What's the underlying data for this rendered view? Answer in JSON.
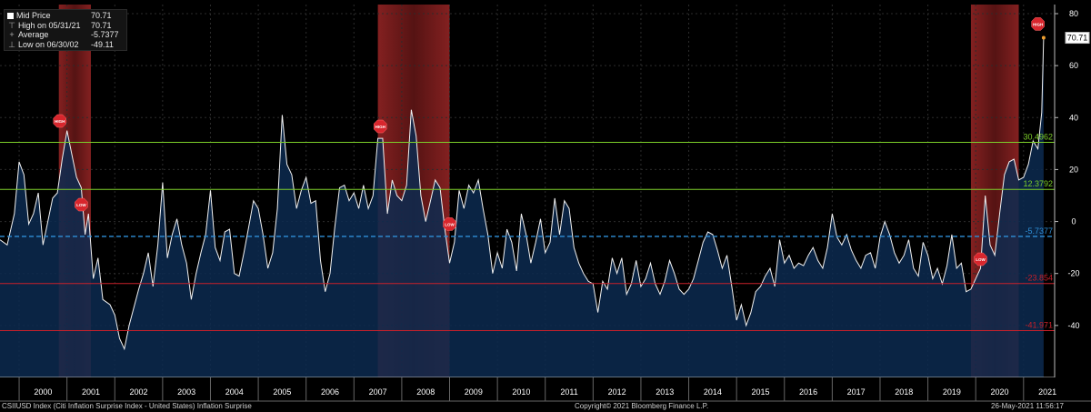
{
  "legend": {
    "items": [
      {
        "label": "Mid Price",
        "value": "70.71",
        "icon": "white-square"
      },
      {
        "label": "High on 05/31/21",
        "value": "70.71",
        "icon": "high-marker"
      },
      {
        "label": "Average",
        "value": "-5.7377",
        "icon": "average-marker"
      },
      {
        "label": "Low on 06/30/02",
        "value": "-49.11",
        "icon": "low-marker"
      }
    ]
  },
  "footer": {
    "title": "CSIIUSD Index (Citi Inflation Surprise Index - United States) Inflation Surprise",
    "copyright": "Copyright© 2021 Bloomberg Finance L.P.",
    "timestamp": "26-May-2021 11:56:17"
  },
  "chart_data": {
    "type": "area",
    "title": "",
    "ylim": [
      -60,
      80
    ],
    "yticks": [
      "80",
      "60",
      "40",
      "20",
      "0",
      "-20",
      "-40"
    ],
    "x_categories": [
      "2000",
      "2001",
      "2002",
      "2003",
      "2004",
      "2005",
      "2006",
      "2007",
      "2008",
      "2009",
      "2010",
      "2011",
      "2012",
      "2013",
      "2014",
      "2015",
      "2016",
      "2017",
      "2018",
      "2019",
      "2020",
      "2021"
    ],
    "grid": true,
    "last_value_label": "70.71",
    "reference_lines": [
      {
        "value": 30.4962,
        "label": "30.4962",
        "color": "#7dcf2a"
      },
      {
        "value": 12.3792,
        "label": "12.3792",
        "color": "#7dcf2a"
      },
      {
        "value": -5.7377,
        "label": "-5.7377",
        "color": "#2f8fd8",
        "style": "dashed"
      },
      {
        "value": -23.854,
        "label": "-23.854",
        "color": "#c8202a"
      },
      {
        "value": -41.971,
        "label": "-41.971",
        "color": "#c8202a"
      }
    ],
    "shaded_periods": [
      {
        "start": 2000.83,
        "end": 2001.5
      },
      {
        "start": 2007.5,
        "end": 2009.0
      },
      {
        "start": 2019.9,
        "end": 2020.9
      }
    ],
    "series": [
      {
        "values": [
          [
            1999.6,
            -7
          ],
          [
            1999.75,
            -9
          ],
          [
            1999.9,
            3
          ],
          [
            2000.0,
            23
          ],
          [
            2000.1,
            18
          ],
          [
            2000.2,
            -1
          ],
          [
            2000.3,
            3
          ],
          [
            2000.4,
            11
          ],
          [
            2000.5,
            -9
          ],
          [
            2000.6,
            0
          ],
          [
            2000.7,
            9
          ],
          [
            2000.8,
            11
          ],
          [
            2000.9,
            24
          ],
          [
            2001.0,
            35
          ],
          [
            2001.1,
            26
          ],
          [
            2001.2,
            17
          ],
          [
            2001.3,
            13
          ],
          [
            2001.38,
            -5
          ],
          [
            2001.45,
            3
          ],
          [
            2001.55,
            -22
          ],
          [
            2001.65,
            -14
          ],
          [
            2001.75,
            -30
          ],
          [
            2001.9,
            -32
          ],
          [
            2002.0,
            -36
          ],
          [
            2002.1,
            -45
          ],
          [
            2002.2,
            -49
          ],
          [
            2002.3,
            -40
          ],
          [
            2002.4,
            -33
          ],
          [
            2002.5,
            -26
          ],
          [
            2002.6,
            -20
          ],
          [
            2002.7,
            -12
          ],
          [
            2002.8,
            -25
          ],
          [
            2002.9,
            -9
          ],
          [
            2003.0,
            15
          ],
          [
            2003.1,
            -14
          ],
          [
            2003.2,
            -5
          ],
          [
            2003.3,
            1
          ],
          [
            2003.4,
            -9
          ],
          [
            2003.5,
            -16
          ],
          [
            2003.6,
            -30
          ],
          [
            2003.7,
            -20
          ],
          [
            2003.8,
            -12
          ],
          [
            2003.9,
            -5
          ],
          [
            2004.0,
            12
          ],
          [
            2004.1,
            -10
          ],
          [
            2004.2,
            -15
          ],
          [
            2004.3,
            -4
          ],
          [
            2004.4,
            -3
          ],
          [
            2004.5,
            -20
          ],
          [
            2004.6,
            -21
          ],
          [
            2004.7,
            -12
          ],
          [
            2004.8,
            -2
          ],
          [
            2004.9,
            8
          ],
          [
            2005.0,
            5
          ],
          [
            2005.1,
            -5
          ],
          [
            2005.2,
            -18
          ],
          [
            2005.3,
            -12
          ],
          [
            2005.4,
            5
          ],
          [
            2005.5,
            41
          ],
          [
            2005.6,
            22
          ],
          [
            2005.7,
            18
          ],
          [
            2005.8,
            5
          ],
          [
            2005.9,
            12
          ],
          [
            2006.0,
            17
          ],
          [
            2006.1,
            7
          ],
          [
            2006.2,
            8
          ],
          [
            2006.3,
            -15
          ],
          [
            2006.4,
            -27
          ],
          [
            2006.5,
            -20
          ],
          [
            2006.6,
            -2
          ],
          [
            2006.7,
            13
          ],
          [
            2006.8,
            14
          ],
          [
            2006.9,
            8
          ],
          [
            2007.0,
            11
          ],
          [
            2007.1,
            5
          ],
          [
            2007.2,
            14
          ],
          [
            2007.3,
            5
          ],
          [
            2007.4,
            10
          ],
          [
            2007.5,
            32
          ],
          [
            2007.6,
            32
          ],
          [
            2007.7,
            3
          ],
          [
            2007.8,
            16
          ],
          [
            2007.9,
            10
          ],
          [
            2008.0,
            8
          ],
          [
            2008.1,
            14
          ],
          [
            2008.2,
            43
          ],
          [
            2008.3,
            33
          ],
          [
            2008.4,
            10
          ],
          [
            2008.5,
            0
          ],
          [
            2008.6,
            8
          ],
          [
            2008.7,
            16
          ],
          [
            2008.8,
            13
          ],
          [
            2008.9,
            -3
          ],
          [
            2009.0,
            -16
          ],
          [
            2009.1,
            -8
          ],
          [
            2009.2,
            12
          ],
          [
            2009.3,
            5
          ],
          [
            2009.4,
            14
          ],
          [
            2009.5,
            11
          ],
          [
            2009.6,
            16
          ],
          [
            2009.7,
            5
          ],
          [
            2009.8,
            -5
          ],
          [
            2009.9,
            -20
          ],
          [
            2010.0,
            -12
          ],
          [
            2010.1,
            -18
          ],
          [
            2010.2,
            -3
          ],
          [
            2010.3,
            -8
          ],
          [
            2010.4,
            -19
          ],
          [
            2010.5,
            3
          ],
          [
            2010.6,
            -5
          ],
          [
            2010.7,
            -16
          ],
          [
            2010.8,
            -8
          ],
          [
            2010.9,
            1
          ],
          [
            2011.0,
            -12
          ],
          [
            2011.1,
            -8
          ],
          [
            2011.2,
            9
          ],
          [
            2011.3,
            -5
          ],
          [
            2011.4,
            8
          ],
          [
            2011.5,
            5
          ],
          [
            2011.6,
            -10
          ],
          [
            2011.7,
            -16
          ],
          [
            2011.8,
            -20
          ],
          [
            2011.9,
            -23
          ],
          [
            2012.0,
            -24
          ],
          [
            2012.1,
            -35
          ],
          [
            2012.2,
            -23
          ],
          [
            2012.3,
            -26
          ],
          [
            2012.4,
            -14
          ],
          [
            2012.5,
            -20
          ],
          [
            2012.6,
            -14
          ],
          [
            2012.7,
            -28
          ],
          [
            2012.8,
            -24
          ],
          [
            2012.9,
            -15
          ],
          [
            2013.0,
            -25
          ],
          [
            2013.1,
            -22
          ],
          [
            2013.2,
            -16
          ],
          [
            2013.3,
            -24
          ],
          [
            2013.4,
            -28
          ],
          [
            2013.5,
            -23
          ],
          [
            2013.6,
            -15
          ],
          [
            2013.7,
            -20
          ],
          [
            2013.8,
            -26
          ],
          [
            2013.9,
            -28
          ],
          [
            2014.0,
            -26
          ],
          [
            2014.1,
            -22
          ],
          [
            2014.2,
            -15
          ],
          [
            2014.3,
            -8
          ],
          [
            2014.4,
            -4
          ],
          [
            2014.5,
            -5
          ],
          [
            2014.6,
            -11
          ],
          [
            2014.7,
            -18
          ],
          [
            2014.8,
            -13
          ],
          [
            2014.9,
            -25
          ],
          [
            2015.0,
            -38
          ],
          [
            2015.1,
            -32
          ],
          [
            2015.2,
            -40
          ],
          [
            2015.3,
            -35
          ],
          [
            2015.4,
            -27
          ],
          [
            2015.5,
            -25
          ],
          [
            2015.6,
            -21
          ],
          [
            2015.7,
            -18
          ],
          [
            2015.8,
            -25
          ],
          [
            2015.9,
            -7
          ],
          [
            2016.0,
            -16
          ],
          [
            2016.1,
            -13
          ],
          [
            2016.2,
            -18
          ],
          [
            2016.3,
            -16
          ],
          [
            2016.4,
            -17
          ],
          [
            2016.5,
            -13
          ],
          [
            2016.6,
            -10
          ],
          [
            2016.7,
            -15
          ],
          [
            2016.8,
            -18
          ],
          [
            2016.9,
            -10
          ],
          [
            2017.0,
            3
          ],
          [
            2017.1,
            -6
          ],
          [
            2017.2,
            -9
          ],
          [
            2017.3,
            -5
          ],
          [
            2017.4,
            -11
          ],
          [
            2017.5,
            -15
          ],
          [
            2017.6,
            -18
          ],
          [
            2017.7,
            -13
          ],
          [
            2017.8,
            -12
          ],
          [
            2017.9,
            -18
          ],
          [
            2018.0,
            -6
          ],
          [
            2018.1,
            0
          ],
          [
            2018.2,
            -5
          ],
          [
            2018.3,
            -12
          ],
          [
            2018.4,
            -16
          ],
          [
            2018.5,
            -13
          ],
          [
            2018.6,
            -7
          ],
          [
            2018.7,
            -18
          ],
          [
            2018.8,
            -21
          ],
          [
            2018.9,
            -8
          ],
          [
            2019.0,
            -13
          ],
          [
            2019.1,
            -22
          ],
          [
            2019.2,
            -18
          ],
          [
            2019.3,
            -24
          ],
          [
            2019.4,
            -17
          ],
          [
            2019.5,
            -5
          ],
          [
            2019.6,
            -18
          ],
          [
            2019.7,
            -16
          ],
          [
            2019.8,
            -27
          ],
          [
            2019.9,
            -26
          ],
          [
            2020.0,
            -22
          ],
          [
            2020.1,
            -18
          ],
          [
            2020.2,
            10
          ],
          [
            2020.3,
            -9
          ],
          [
            2020.4,
            -13
          ],
          [
            2020.5,
            3
          ],
          [
            2020.6,
            18
          ],
          [
            2020.7,
            23
          ],
          [
            2020.8,
            24
          ],
          [
            2020.9,
            16
          ],
          [
            2021.0,
            17
          ],
          [
            2021.1,
            22
          ],
          [
            2021.2,
            31
          ],
          [
            2021.3,
            28
          ],
          [
            2021.38,
            42
          ],
          [
            2021.42,
            70.71
          ]
        ]
      }
    ],
    "markers": [
      {
        "x": 2000.85,
        "y": 38.7,
        "label": "HIGH"
      },
      {
        "x": 2001.3,
        "y": 6.5,
        "label": "LOW"
      },
      {
        "x": 2007.55,
        "y": 36.6,
        "label": "HIGH"
      },
      {
        "x": 2009.0,
        "y": -1,
        "label": "LOW"
      },
      {
        "x": 2020.1,
        "y": -14.5,
        "label": "LOW"
      },
      {
        "x": 2021.3,
        "y": 76,
        "label": "HIGH"
      }
    ]
  }
}
